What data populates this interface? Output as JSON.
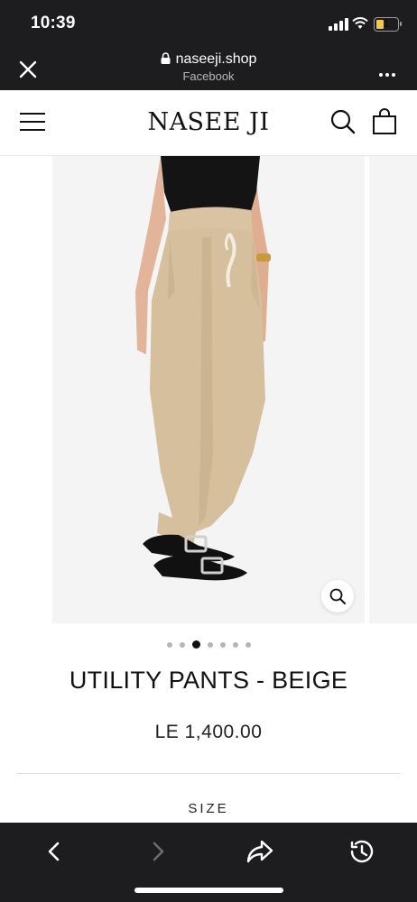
{
  "status_bar": {
    "time": "10:39",
    "battery_level": "1"
  },
  "browser": {
    "domain": "naseeji.shop",
    "source": "Facebook"
  },
  "site": {
    "logo_text": "NASEE JI"
  },
  "gallery": {
    "image_count": 7,
    "active_index": 2
  },
  "product": {
    "title": "UTILITY PANTS - BEIGE",
    "price": "LE 1,400.00",
    "size_label": "SIZE"
  },
  "icons": {
    "close": "close-icon",
    "lock": "lock-icon",
    "more": "more-icon",
    "menu": "menu-icon",
    "search": "search-icon",
    "bag": "shopping-bag-icon",
    "zoom": "zoom-icon",
    "back": "back-icon",
    "forward": "forward-icon",
    "share": "share-icon",
    "history": "history-icon"
  },
  "colors": {
    "chrome": "#1d1d1f",
    "pants": "#d6bf9c",
    "background": "#ffffff"
  }
}
